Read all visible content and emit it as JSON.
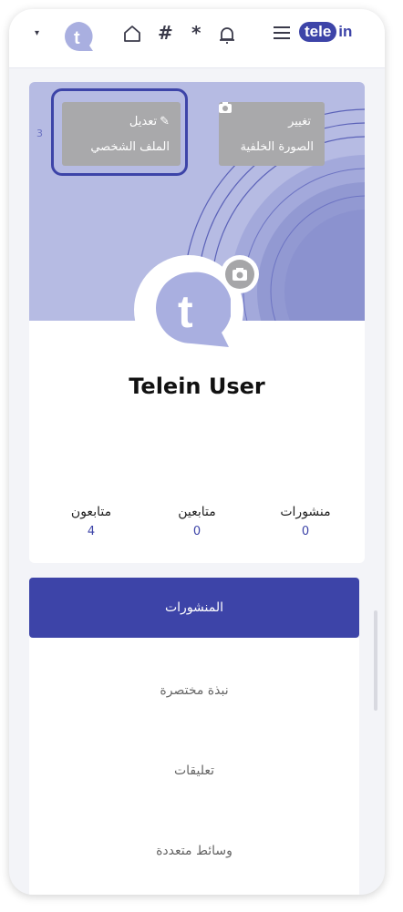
{
  "topbar": {
    "caret": "▾",
    "hash": "#",
    "star": "*",
    "brand_left": "tele",
    "brand_right": "in"
  },
  "profile": {
    "cover_badge": "3",
    "edit_line1": "تعديل",
    "edit_line2": "الملف الشخصي",
    "cover_line1": "تغيير",
    "cover_line2": "الصورة الخلفية",
    "name": "Telein User"
  },
  "stats": [
    {
      "label": "منشورات",
      "value": "0"
    },
    {
      "label": "متابعين",
      "value": "0"
    },
    {
      "label": "متابعون",
      "value": "4"
    }
  ],
  "tabs": [
    {
      "label": "المنشورات",
      "active": true
    },
    {
      "label": "نبذة مختصرة"
    },
    {
      "label": "تعليقات"
    },
    {
      "label": "وسائط متعددة"
    }
  ],
  "colors": {
    "accent": "#3d44a8",
    "cover": "#b6bbe3",
    "button_gray": "#a9a9ab"
  }
}
